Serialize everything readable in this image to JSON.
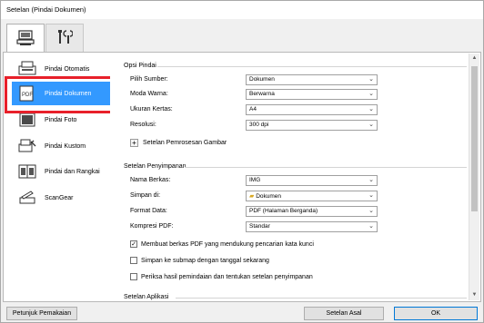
{
  "window": {
    "title": "Setelan (Pindai Dokumen)"
  },
  "tabs": [
    {
      "icon": "scanner-computer-icon",
      "active": true
    },
    {
      "icon": "tools-icon",
      "active": false
    }
  ],
  "nav": {
    "items": [
      {
        "label": "Pindai Otomatis",
        "icon": "auto-scan-icon"
      },
      {
        "label": "Pindai Dokumen",
        "icon": "pdf-document-icon",
        "selected": true
      },
      {
        "label": "Pindai Foto",
        "icon": "photo-icon"
      },
      {
        "label": "Pindai Kustom",
        "icon": "custom-scan-icon"
      },
      {
        "label": "Pindai dan Rangkai",
        "icon": "stitch-icon"
      },
      {
        "label": "ScanGear",
        "icon": "scangear-icon"
      }
    ]
  },
  "scan_options": {
    "title": "Opsi Pindai",
    "fields": [
      {
        "label": "Pilih Sumber:",
        "value": "Dokumen"
      },
      {
        "label": "Moda Warna:",
        "value": "Berwarna"
      },
      {
        "label": "Ukuran Kertas:",
        "value": "A4"
      },
      {
        "label": "Resolusi:",
        "value": "300 dpi"
      }
    ],
    "image_processing": "Setelan Pemrosesan Gambar"
  },
  "save_settings": {
    "title": "Setelan Penyimpanan",
    "fields": [
      {
        "label": "Nama Berkas:",
        "value": "IMG"
      },
      {
        "label": "Simpan di:",
        "value": "Dokumen"
      },
      {
        "label": "Format Data:",
        "value": "PDF (Halaman Berganda)"
      },
      {
        "label": "Kompresi PDF:",
        "value": "Standar"
      }
    ],
    "checkboxes": [
      {
        "label": "Membuat berkas PDF yang mendukung pencarian kata kunci",
        "checked": true
      },
      {
        "label": "Simpan ke submap dengan tanggal sekarang",
        "checked": false
      },
      {
        "label": "Periksa hasil pemindaian dan tentukan setelan penyimpanan",
        "checked": false
      }
    ]
  },
  "app_settings": {
    "title": "Setelan Aplikasi"
  },
  "buttons": {
    "help": "Petunjuk Pemakaian",
    "defaults": "Setelan Asal",
    "ok": "OK"
  },
  "colors": {
    "selection": "#3399ff",
    "highlight": "#e8202a"
  }
}
